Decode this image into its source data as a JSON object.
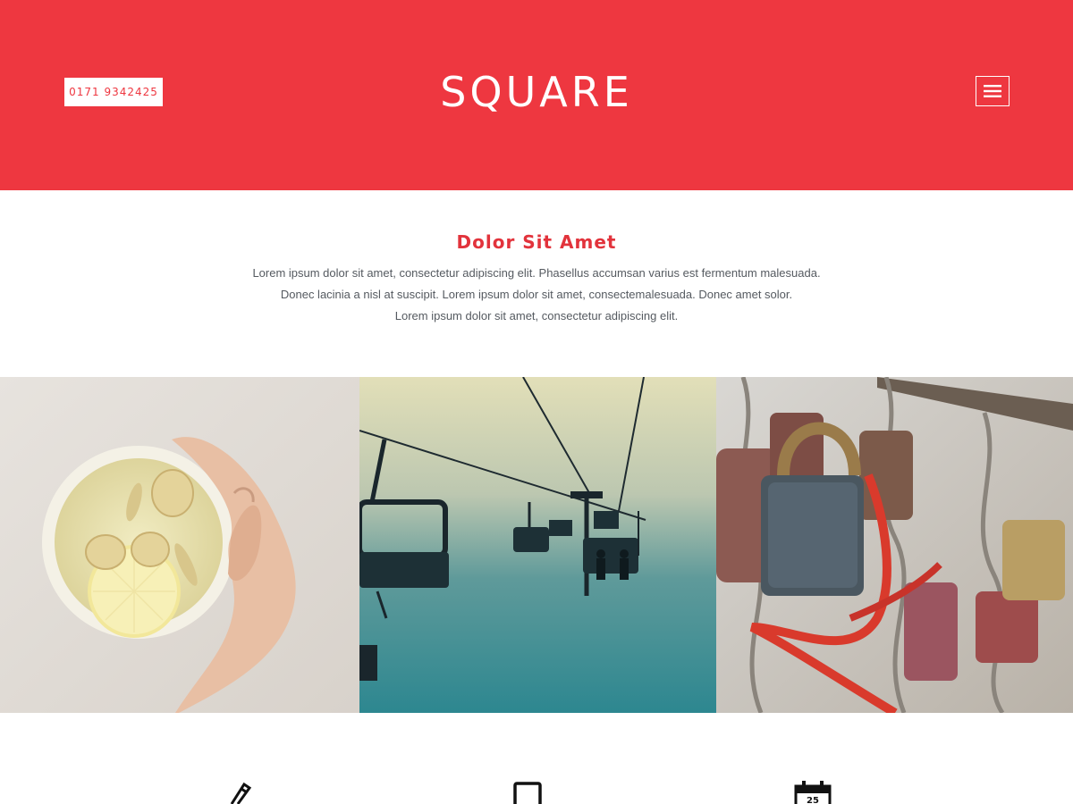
{
  "header": {
    "phone": "0171 9342425",
    "logo": "SQUARE",
    "brand_color": "#ee3740",
    "menu_icon": "hamburger-menu-icon"
  },
  "intro": {
    "title": "Dolor Sit Amet",
    "lines": [
      "Lorem ipsum dolor sit amet, consectetur adipiscing elit. Phasellus accumsan varius est fermentum malesuada.",
      "Donec lacinia a nisl at suscipit. Lorem ipsum dolor sit amet, consectemalesuada. Donec amet solor.",
      "Lorem ipsum dolor sit amet, consectetur adipiscing elit."
    ]
  },
  "gallery": {
    "images": [
      {
        "subject": "ginger-lemon-tea-photo"
      },
      {
        "subject": "ski-chairlift-photo"
      },
      {
        "subject": "love-padlocks-photo"
      }
    ]
  },
  "features": {
    "icons": [
      "pencil-icon",
      "tablet-icon",
      "calendar-icon"
    ],
    "calendar_day": "25"
  }
}
